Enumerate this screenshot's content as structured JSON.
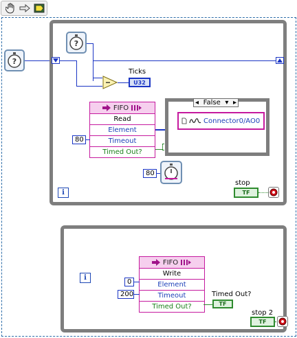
{
  "toolbar": {
    "items": [
      {
        "name": "hand-icon"
      },
      {
        "name": "arrow-right-icon"
      },
      {
        "name": "run-icon"
      }
    ]
  },
  "loop1": {
    "iteration_label": "i",
    "ticks_label": "Ticks",
    "ticks_indicator": "U32",
    "fifo_read": {
      "title": "FIFO",
      "method": "Read",
      "rows": [
        "Element",
        "Timeout",
        "Timed Out?"
      ]
    },
    "timeout_const": "80",
    "wait_const": "80",
    "case": {
      "selector": "False",
      "node_text": "Connector0/AO0"
    },
    "stop_label": "stop",
    "stop_tf": "TF"
  },
  "loop2": {
    "iteration_label": "i",
    "fifo_write": {
      "title": "FIFO",
      "method": "Write",
      "rows": [
        "Element",
        "Timeout",
        "Timed Out?"
      ]
    },
    "element_const": "0",
    "timeout_const": "200",
    "timed_out_label": "Timed Out?",
    "timed_out_tf": "TF",
    "stop_label": "stop 2",
    "stop_tf": "TF"
  },
  "colors": {
    "wire_numeric": "#1a35c4",
    "wire_boolean": "#2e8b2e",
    "fifo_border": "#c5199e",
    "loop_border": "#7e7e7e"
  }
}
